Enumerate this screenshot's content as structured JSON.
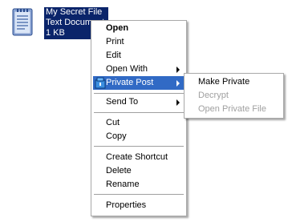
{
  "colors": {
    "selection": "#0a246a",
    "menu_highlight": "#316ac5",
    "disabled_text": "#a0a0a0"
  },
  "file": {
    "icon": "text-document-icon",
    "name": "My Secret File",
    "type": "Text Document",
    "size": "1 KB"
  },
  "context_menu": {
    "open": "Open",
    "print": "Print",
    "edit": "Edit",
    "open_with": "Open With",
    "private_post": "Private Post",
    "private_post_icon": "private-post-icon",
    "send_to": "Send To",
    "cut": "Cut",
    "copy": "Copy",
    "create_shortcut": "Create Shortcut",
    "delete": "Delete",
    "rename": "Rename",
    "properties": "Properties"
  },
  "submenu": {
    "make_private": "Make Private",
    "decrypt": "Decrypt",
    "open_private_file": "Open Private File"
  }
}
